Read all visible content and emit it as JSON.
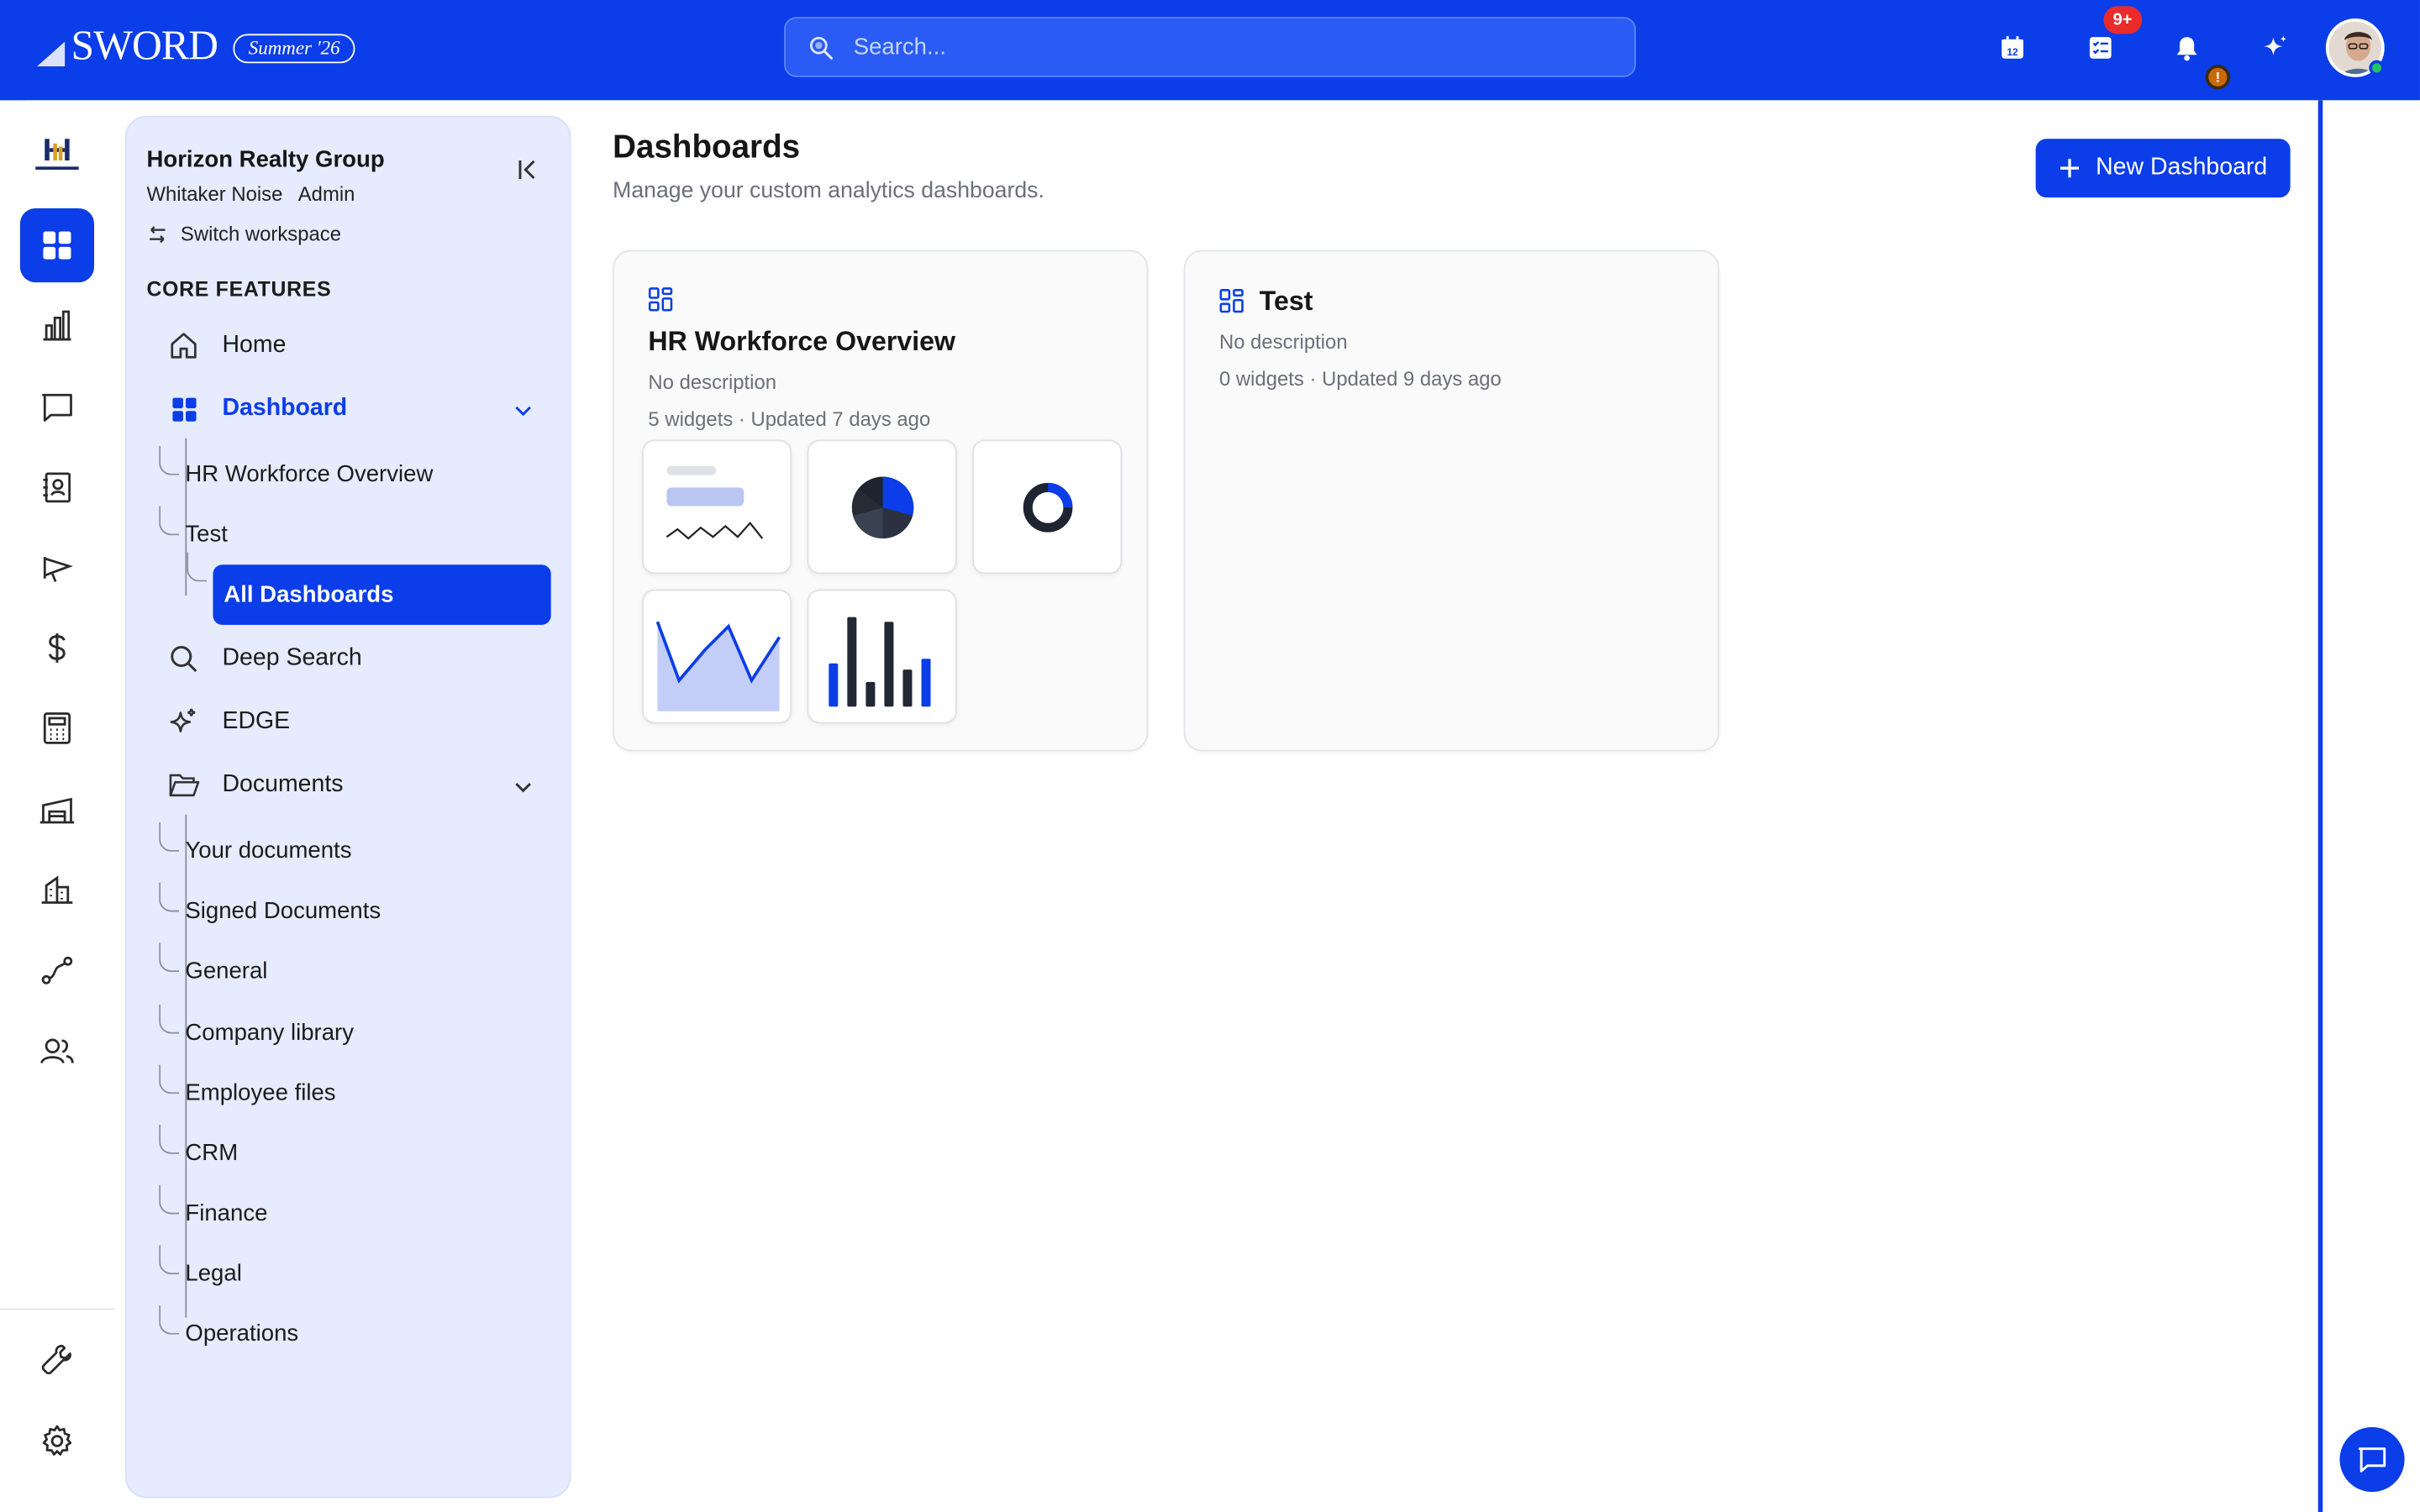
{
  "brand": {
    "name": "SWORD",
    "edition": "Summer '26"
  },
  "search": {
    "placeholder": "Search..."
  },
  "topbar": {
    "calendar_day": "12",
    "tasks_badge": "9+",
    "alert_badge": "!"
  },
  "colors": {
    "accent": "#0b3de8",
    "panel_bg": "#e6ebfd",
    "badge_red": "#ea2b2b",
    "online": "#22c55e"
  },
  "rail": {
    "items": [
      {
        "name": "dashboard-icon",
        "active": true
      },
      {
        "name": "bar-chart-icon"
      },
      {
        "name": "message-icon"
      },
      {
        "name": "contacts-icon"
      },
      {
        "name": "megaphone-icon"
      },
      {
        "name": "dollar-icon"
      },
      {
        "name": "calculator-icon"
      },
      {
        "name": "warehouse-icon"
      },
      {
        "name": "building-icon"
      },
      {
        "name": "route-icon"
      },
      {
        "name": "users-icon"
      }
    ],
    "bottom": [
      {
        "name": "wrench-icon"
      },
      {
        "name": "settings-icon"
      }
    ]
  },
  "workspace": {
    "name": "Horizon Realty Group",
    "user": "Whitaker Noise",
    "role": "Admin",
    "switch_label": "Switch workspace"
  },
  "sidebar": {
    "section_title": "CORE FEATURES",
    "home": "Home",
    "dashboard": "Dashboard",
    "dashboard_children": [
      "HR Workforce Overview",
      "Test",
      "All Dashboards"
    ],
    "deep_search": "Deep Search",
    "edge": "EDGE",
    "documents": "Documents",
    "documents_children": [
      "Your documents",
      "Signed Documents",
      "General",
      "Company library",
      "Employee files",
      "CRM",
      "Finance",
      "Legal",
      "Operations"
    ]
  },
  "main": {
    "title": "Dashboards",
    "subtitle": "Manage your custom analytics dashboards.",
    "new_button": "New Dashboard",
    "cards": [
      {
        "title": "HR Workforce Overview",
        "description": "No description",
        "meta": "5 widgets · Updated 7 days ago"
      },
      {
        "title": "Test",
        "description": "No description",
        "meta": "0 widgets · Updated 9 days ago"
      }
    ]
  }
}
